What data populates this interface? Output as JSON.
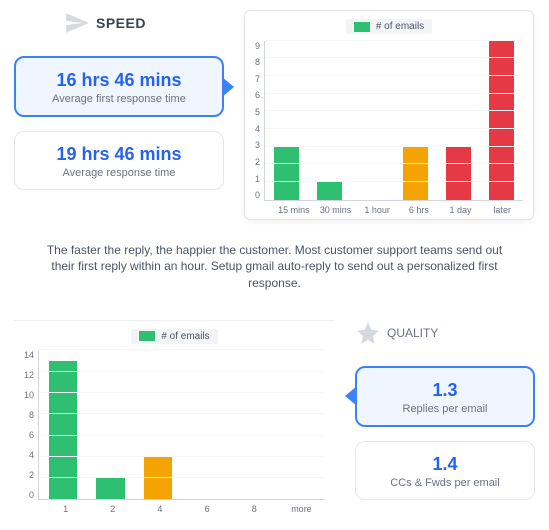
{
  "speed": {
    "title": "SPEED",
    "metrics": [
      {
        "value": "16 hrs 46 mins",
        "label": "Average first response time",
        "active": true
      },
      {
        "value": "19 hrs 46 mins",
        "label": "Average response time",
        "active": false
      }
    ]
  },
  "quality": {
    "title": "QUALITY",
    "metrics": [
      {
        "value": "1.3",
        "label": "Replies per email",
        "active": true
      },
      {
        "value": "1.4",
        "label": "CCs & Fwds per email",
        "active": false
      }
    ]
  },
  "caption": "The faster the reply, the happier the customer. Most customer support teams send out their first reply within an hour. Setup gmail auto-reply to send out a personalized first response.",
  "chart_data": [
    {
      "type": "bar",
      "legend": "# of emails",
      "categories": [
        "15 mins",
        "30 mins",
        "1 hour",
        "6 hrs",
        "1 day",
        "later"
      ],
      "values": [
        3,
        1,
        0,
        3,
        3,
        9
      ],
      "colors": [
        "#2fbf71",
        "#2fbf71",
        "#2fbf71",
        "#f4a300",
        "#e63946",
        "#e63946"
      ],
      "ylim": [
        0,
        9
      ],
      "yticks": [
        0,
        1,
        2,
        3,
        4,
        5,
        6,
        7,
        8,
        9
      ]
    },
    {
      "type": "bar",
      "legend": "# of emails",
      "categories": [
        "1",
        "2",
        "4",
        "6",
        "8",
        "more"
      ],
      "values": [
        13,
        2,
        4,
        0,
        0,
        0
      ],
      "colors": [
        "#2fbf71",
        "#2fbf71",
        "#f4a300",
        "#2fbf71",
        "#2fbf71",
        "#e63946"
      ],
      "ylim": [
        0,
        14
      ],
      "yticks": [
        0,
        2,
        4,
        6,
        8,
        10,
        12,
        14
      ]
    }
  ],
  "colors": {
    "green": "#2fbf71",
    "orange": "#f4a300",
    "red": "#e63946",
    "blue": "#2563eb"
  }
}
